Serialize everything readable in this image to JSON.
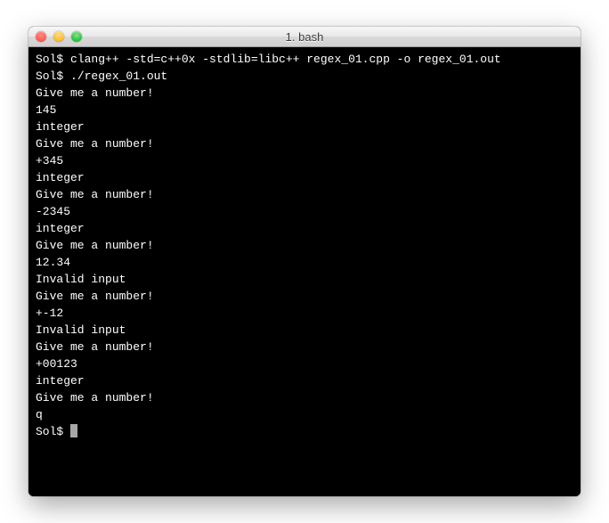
{
  "window": {
    "title": "1. bash"
  },
  "terminal": {
    "prompt": "Sol$ ",
    "lines": [
      {
        "type": "cmd",
        "text": "clang++ -std=c++0x -stdlib=libc++ regex_01.cpp -o regex_01.out"
      },
      {
        "type": "cmd",
        "text": "./regex_01.out"
      },
      {
        "type": "out",
        "text": "Give me a number!"
      },
      {
        "type": "out",
        "text": "145"
      },
      {
        "type": "out",
        "text": "integer"
      },
      {
        "type": "out",
        "text": "Give me a number!"
      },
      {
        "type": "out",
        "text": "+345"
      },
      {
        "type": "out",
        "text": "integer"
      },
      {
        "type": "out",
        "text": "Give me a number!"
      },
      {
        "type": "out",
        "text": "-2345"
      },
      {
        "type": "out",
        "text": "integer"
      },
      {
        "type": "out",
        "text": "Give me a number!"
      },
      {
        "type": "out",
        "text": "12.34"
      },
      {
        "type": "out",
        "text": "Invalid input"
      },
      {
        "type": "out",
        "text": "Give me a number!"
      },
      {
        "type": "out",
        "text": "+-12"
      },
      {
        "type": "out",
        "text": "Invalid input"
      },
      {
        "type": "out",
        "text": "Give me a number!"
      },
      {
        "type": "out",
        "text": "+00123"
      },
      {
        "type": "out",
        "text": "integer"
      },
      {
        "type": "out",
        "text": "Give me a number!"
      },
      {
        "type": "out",
        "text": "q"
      },
      {
        "type": "cursor",
        "text": ""
      }
    ]
  }
}
